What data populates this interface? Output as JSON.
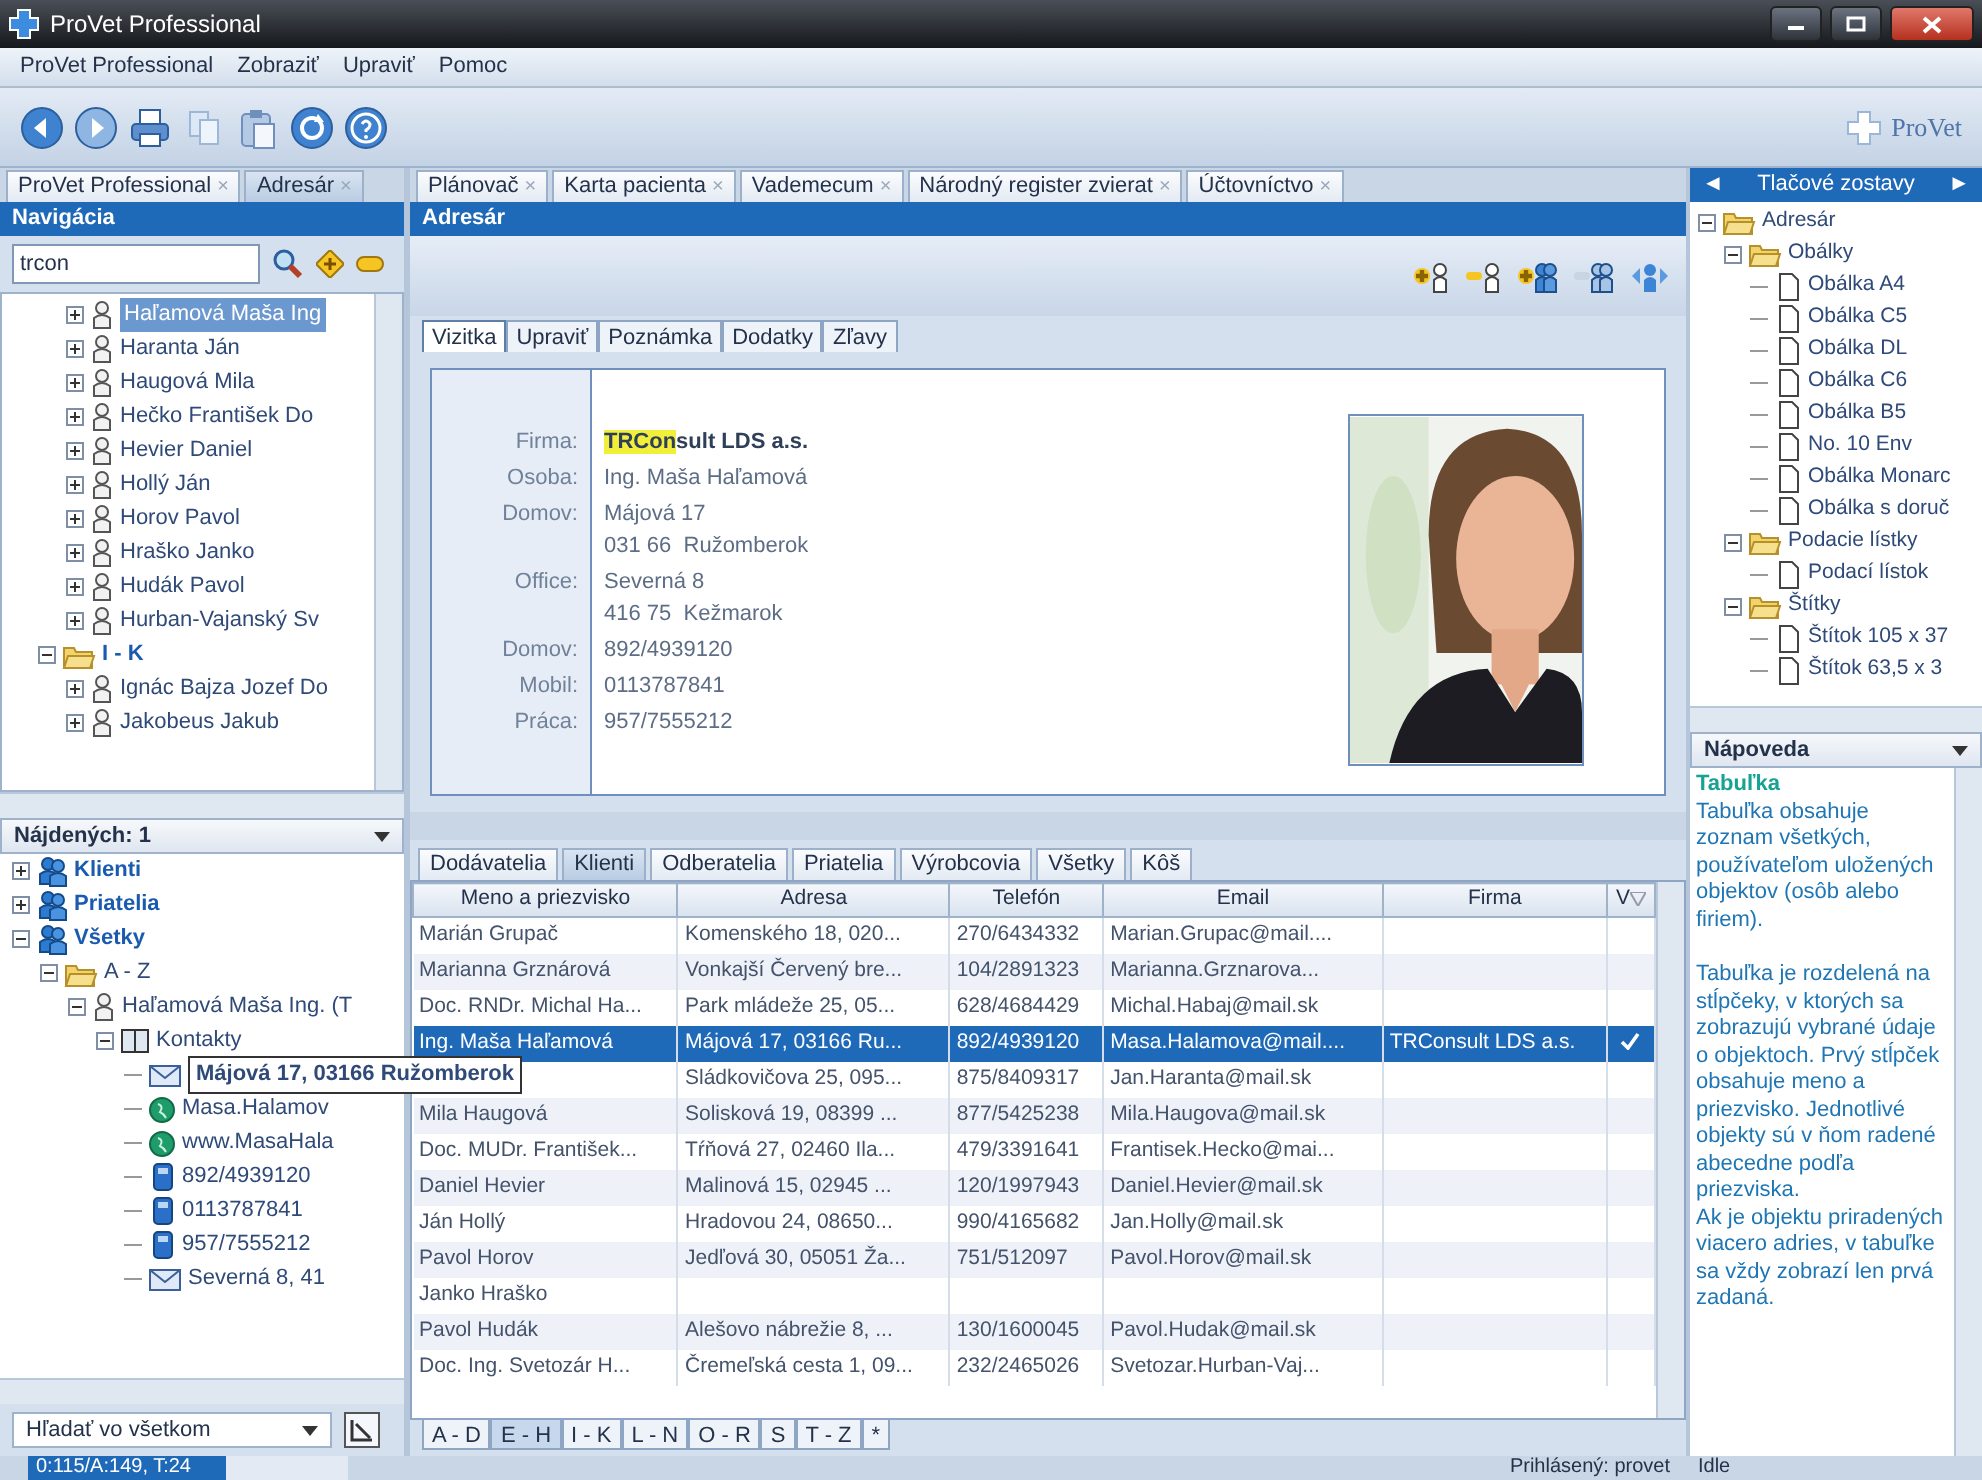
{
  "window": {
    "title": "ProVet Professional"
  },
  "menu": [
    "ProVet Professional",
    "Zobraziť",
    "Upraviť",
    "Pomoc"
  ],
  "toolbar": {
    "brand": "ProVet"
  },
  "left_tabs": [
    {
      "label": "ProVet Professional",
      "close": "×",
      "selected": false
    },
    {
      "label": "Adresár",
      "close": "×",
      "selected": true
    }
  ],
  "center_tabs": [
    {
      "label": "Plánovač",
      "close": "×",
      "selected": false
    },
    {
      "label": "Karta pacienta",
      "close": "×",
      "selected": false
    },
    {
      "label": "Vademecum",
      "close": "×",
      "selected": false
    },
    {
      "label": "Národný register zvierat",
      "close": "×",
      "selected": false
    },
    {
      "label": "Účtovníctvo",
      "close": "×",
      "selected": false
    }
  ],
  "navigation": {
    "title": "Navigácia",
    "search": {
      "value": "trcon"
    },
    "tree": {
      "group_items": [
        {
          "label": "Haľamová Maša Ing",
          "expanded": false,
          "selected": true
        },
        {
          "label": "Haranta Ján",
          "expanded": false,
          "selected": false
        },
        {
          "label": "Haugová Mila",
          "expanded": false,
          "selected": false
        },
        {
          "label": "Hečko František Do",
          "expanded": false,
          "selected": false
        },
        {
          "label": "Hevier Daniel",
          "expanded": false,
          "selected": false
        },
        {
          "label": "Hollý Ján",
          "expanded": false,
          "selected": false
        },
        {
          "label": "Horov Pavol",
          "expanded": false,
          "selected": false
        },
        {
          "label": "Hraško Janko",
          "expanded": false,
          "selected": false
        },
        {
          "label": "Hudák Pavol",
          "expanded": false,
          "selected": false
        },
        {
          "label": "Hurban-Vajanský Sv",
          "expanded": false,
          "selected": false
        }
      ],
      "folders": [
        {
          "label": "I - K",
          "expanded": true,
          "children": [
            {
              "label": "Ignác Bajza Jozef Do",
              "expanded": false,
              "selected": false
            },
            {
              "label": "Jakobeus Jakub",
              "expanded": false,
              "selected": false
            }
          ]
        }
      ]
    },
    "found": {
      "label": "Nájdených: 1"
    },
    "results": [
      {
        "kind": "group",
        "label": "Klienti",
        "expanded": false
      },
      {
        "kind": "group",
        "label": "Priatelia",
        "expanded": false
      },
      {
        "kind": "group",
        "label": "Všetky",
        "expanded": true,
        "children": [
          {
            "kind": "folder",
            "label": "A - Z",
            "expanded": true,
            "children": [
              {
                "kind": "person",
                "label": "Haľamová Maša Ing. (T",
                "expanded": true,
                "children": [
                  {
                    "kind": "book",
                    "label": "Kontakty",
                    "expanded": true,
                    "children": [
                      {
                        "kind": "address",
                        "label": "Májová 17, 03166 Ružomberok",
                        "highlighted": true
                      },
                      {
                        "kind": "web",
                        "label": "Masa.Halamov",
                        "highlighted": false
                      },
                      {
                        "kind": "web",
                        "label": "www.MasaHala",
                        "highlighted": false
                      },
                      {
                        "kind": "phone",
                        "label": "892/4939120",
                        "highlighted": false
                      },
                      {
                        "kind": "phone",
                        "label": "0113787841",
                        "highlighted": false
                      },
                      {
                        "kind": "phone",
                        "label": "957/7555212",
                        "highlighted": false
                      },
                      {
                        "kind": "address",
                        "label": "Severná 8, 41",
                        "highlighted": false
                      }
                    ]
                  }
                ]
              }
            ]
          }
        ]
      }
    ],
    "scope": {
      "value": "Hľadať vo všetkom"
    }
  },
  "address_book": {
    "title": "Adresár",
    "detail_tabs": [
      {
        "label": "Vizitka",
        "selected": true
      },
      {
        "label": "Upraviť",
        "selected": false
      },
      {
        "label": "Poznámka",
        "selected": false
      },
      {
        "label": "Dodatky",
        "selected": false
      },
      {
        "label": "Zľavy",
        "selected": false
      }
    ],
    "card": [
      {
        "kind": "firm",
        "label": "Firma:",
        "parts": [
          {
            "text": "TRCon",
            "highlighted": true
          },
          {
            "text": "sult LDS a.s.",
            "highlighted": false
          }
        ]
      },
      {
        "kind": "text",
        "label": "Osoba:",
        "lines": [
          "Ing. Maša Haľamová"
        ]
      },
      {
        "kind": "text",
        "label": "Domov:",
        "lines": [
          "Májová 17",
          "031 66  Ružomberok"
        ]
      },
      {
        "kind": "text",
        "label": "Office:",
        "lines": [
          "Severná 8",
          "416 75  Kežmarok"
        ]
      },
      {
        "kind": "text",
        "label": "Domov:",
        "lines": [
          "892/4939120"
        ]
      },
      {
        "kind": "text",
        "label": "Mobil:",
        "lines": [
          "0113787841"
        ]
      },
      {
        "kind": "text",
        "label": "Práca:",
        "lines": [
          "957/7555212"
        ]
      }
    ],
    "list_tabs": [
      {
        "label": "Dodávatelia",
        "selected": false
      },
      {
        "label": "Klienti",
        "selected": true
      },
      {
        "label": "Odberatelia",
        "selected": false
      },
      {
        "label": "Priatelia",
        "selected": false
      },
      {
        "label": "Výrobcovia",
        "selected": false
      },
      {
        "label": "Všetky",
        "selected": false
      },
      {
        "label": "Kôš",
        "selected": false
      }
    ],
    "table": {
      "columns": [
        "Meno a priezvisko",
        "Adresa",
        "Telefón",
        "Email",
        "Firma",
        "V"
      ],
      "rows": [
        {
          "name": "Marián Grupač",
          "address": "Komenského 18, 020...",
          "phone": "270/6434332",
          "email": "Marian.Grupac@mail....",
          "selected": false,
          "v_checked": false
        },
        {
          "name": "Marianna Grznárová",
          "address": "Vonkajší Červený bre...",
          "phone": "104/2891323",
          "email": "Marianna.Grznarova...",
          "selected": false,
          "v_checked": false
        },
        {
          "name": "Doc. RNDr. Michal Ha...",
          "address": "Park mládeže 25, 05...",
          "phone": "628/4684429",
          "email": "Michal.Habaj@mail.sk",
          "selected": false,
          "v_checked": false
        },
        {
          "name": "Ing. Maša Haľamová",
          "address": "Májová 17, 03166 Ru...",
          "phone": "892/4939120",
          "email": "Masa.Halamova@mail....",
          "firm": "TRConsult LDS a.s.",
          "selected": true,
          "v_checked": true
        },
        {
          "address": "Sládkovičova 25, 095...",
          "phone": "875/8409317",
          "email": "Jan.Haranta@mail.sk",
          "selected": false,
          "v_checked": false
        },
        {
          "name": "Mila Haugová",
          "address": "Solisková 19, 08399 ...",
          "phone": "877/5425238",
          "email": "Mila.Haugova@mail.sk",
          "selected": false,
          "v_checked": false
        },
        {
          "name": "Doc. MUDr. František...",
          "address": "Tŕňová 27, 02460 Ila...",
          "phone": "479/3391641",
          "email": "Frantisek.Hecko@mai...",
          "selected": false,
          "v_checked": false
        },
        {
          "name": "Daniel Hevier",
          "address": "Malinová 15, 02945 ...",
          "phone": "120/1997943",
          "email": "Daniel.Hevier@mail.sk",
          "selected": false,
          "v_checked": false
        },
        {
          "name": "Ján Hollý",
          "address": "Hradovou 24, 08650...",
          "phone": "990/4165682",
          "email": "Jan.Holly@mail.sk",
          "selected": false,
          "v_checked": false
        },
        {
          "name": "Pavol Horov",
          "address": "Jedľová 30, 05051 Ža...",
          "phone": "751/512097",
          "email": "Pavol.Horov@mail.sk",
          "selected": false,
          "v_checked": false
        },
        {
          "name": "Janko Hraško",
          "selected": false,
          "v_checked": false
        },
        {
          "name": "Pavol Hudák",
          "address": "Alešovo nábrežie 8, ...",
          "phone": "130/1600045",
          "email": "Pavol.Hudak@mail.sk",
          "selected": false,
          "v_checked": false
        },
        {
          "name": "Doc. Ing. Svetozár H...",
          "address": "Čremeľská cesta 1, 09...",
          "phone": "232/2465026",
          "email": "Svetozar.Hurban-Vaj...",
          "selected": false,
          "v_checked": false
        }
      ]
    },
    "letter_tabs": [
      {
        "label": "A - D",
        "selected": false
      },
      {
        "label": "E - H",
        "selected": true
      },
      {
        "label": "I - K",
        "selected": false
      },
      {
        "label": "L - N",
        "selected": false
      },
      {
        "label": "O - R",
        "selected": false
      },
      {
        "label": "S",
        "selected": false
      },
      {
        "label": "T - Z",
        "selected": false
      },
      {
        "label": "*",
        "selected": false
      }
    ]
  },
  "reports": {
    "prev": "◄",
    "title": "Tlačové zostavy",
    "next": "►",
    "tree": [
      {
        "kind": "folder",
        "label": "Adresár",
        "expanded": true,
        "children": [
          {
            "kind": "folder",
            "label": "Obálky",
            "expanded": true,
            "children": [
              {
                "kind": "doc",
                "label": "Obálka A4"
              },
              {
                "kind": "doc",
                "label": "Obálka C5"
              },
              {
                "kind": "doc",
                "label": "Obálka DL"
              },
              {
                "kind": "doc",
                "label": "Obálka C6"
              },
              {
                "kind": "doc",
                "label": "Obálka B5"
              },
              {
                "kind": "doc",
                "label": "No. 10 Env"
              },
              {
                "kind": "doc",
                "label": "Obálka Monarc"
              },
              {
                "kind": "doc",
                "label": "Obálka s doruč"
              }
            ]
          },
          {
            "kind": "folder",
            "label": "Podacie lístky",
            "expanded": true,
            "children": [
              {
                "kind": "doc",
                "label": "Podací lístok"
              }
            ]
          },
          {
            "kind": "folder",
            "label": "Štítky",
            "expanded": true,
            "children": [
              {
                "kind": "doc",
                "label": "Štítok 105 x 37"
              },
              {
                "kind": "doc",
                "label": "Štítok 63,5 x 3"
              }
            ]
          }
        ]
      }
    ]
  },
  "help": {
    "label": "Nápoveda",
    "heading": "Tabuľka",
    "paragraphs": [
      "Tabuľka obsahuje zoznam všetkých, používateľom uložených objektov (osôb alebo firiem).",
      "Tabuľka je rozdelená na stĺpčeky, v ktorých sa zobrazujú vybrané údaje o objektoch. Prvý stĺpček obsahuje meno a priezvisko. Jednotlivé objekty sú v ňom radené abecedne podľa priezviska.\nAk je objektu priradených viacero adries, v tabuľke sa vždy zobrazí len prvá zadaná."
    ]
  },
  "status_bar": {
    "memory": {
      "text": "0:115/A:149, T:24",
      "level": 0.62
    },
    "user": "Prihlásený: provet",
    "state": "Idle"
  }
}
